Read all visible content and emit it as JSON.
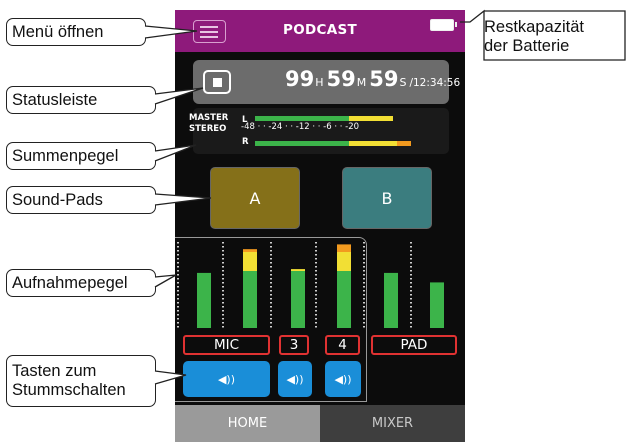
{
  "callouts": {
    "menu": "Menü öffnen",
    "status": "Statusleiste",
    "sum_meter": "Summenpegel",
    "sound_pads": "Sound-Pads",
    "rec_level": "Aufnahmepegel",
    "mute_line1": "Tasten zum",
    "mute_line2": "Stummschalten",
    "battery_line1": "Restkapazität",
    "battery_line2": "der Batterie"
  },
  "header": {
    "title": "PODCAST",
    "menu_icon": "hamburger-icon",
    "battery_icon": "battery-icon"
  },
  "status": {
    "hours": "99",
    "h_unit": "H",
    "minutes": "59",
    "m_unit": "M",
    "seconds": "59",
    "s_unit": "S",
    "total": "/12:34:56",
    "stop_icon": "stop-icon"
  },
  "master_meter": {
    "label_master": "MASTER",
    "label_stereo": "STEREO",
    "label_l": "L",
    "label_r": "R",
    "scale": "-48 · · -24 · · -12 · · -6 · · -20"
  },
  "pads": {
    "a": "A",
    "b": "B"
  },
  "channels": {
    "mic_label": "MIC",
    "ch3_label": "3",
    "ch4_label": "4",
    "pad_label": "PAD",
    "levels": [
      0.58,
      0.83,
      0.62,
      0.88,
      0.58,
      0.48
    ],
    "mute_icon": "speaker-icon",
    "mute_symbol": "◀))"
  },
  "tabs": {
    "home": "HOME",
    "mixer": "MIXER"
  },
  "colors": {
    "header": "#8e1a7b",
    "meter_green": "#3cb44a",
    "meter_yellow": "#f2df34",
    "meter_orange": "#f29a1f",
    "mute_blue": "#1a8ed8",
    "label_red": "#e03232"
  }
}
